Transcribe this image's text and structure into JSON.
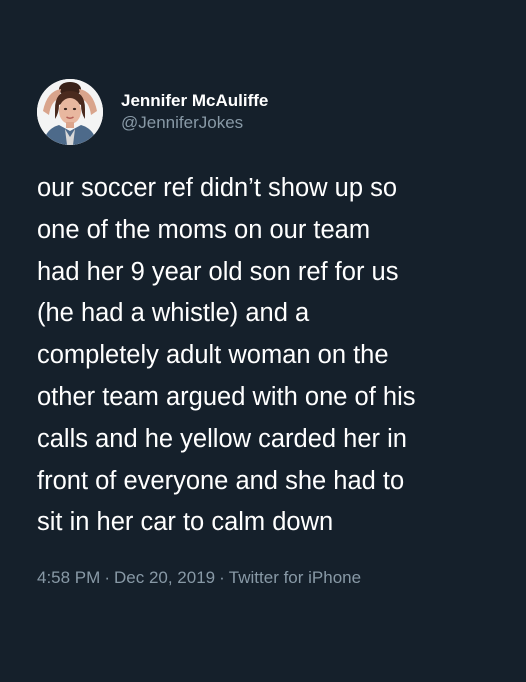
{
  "tweet": {
    "author": {
      "display_name": "Jennifer McAuliffe",
      "handle": "@JenniferJokes",
      "avatar_icon": "user-avatar"
    },
    "text": "our soccer ref didn’t show up so\none of the moms on our team\nhad her 9 year old son ref for us\n(he had a whistle) and a\ncompletely adult woman on the\nother team argued with one of his\ncalls and he yellow carded her in\nfront of everyone and she had to\nsit in her car to calm down",
    "time": "4:58 PM",
    "date": "Dec 20, 2019",
    "source": "Twitter for iPhone",
    "separator": "·"
  },
  "colors": {
    "background": "#15202b",
    "primary_text": "#ffffff",
    "secondary_text": "#8899a6"
  }
}
